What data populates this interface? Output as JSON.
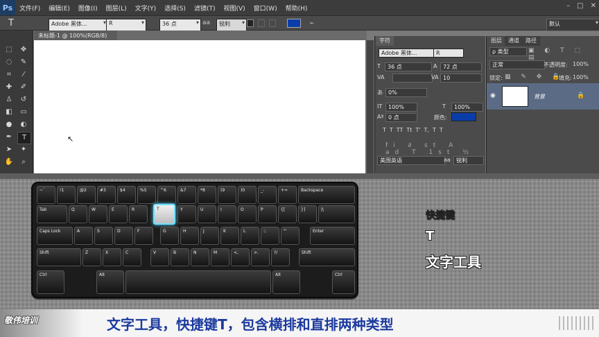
{
  "menubar": {
    "logo": "Ps",
    "items": [
      "文件(F)",
      "编辑(E)",
      "图像(I)",
      "图层(L)",
      "文字(Y)",
      "选择(S)",
      "滤镜(T)",
      "视图(V)",
      "窗口(W)",
      "帮助(H)"
    ],
    "window_controls": [
      "–",
      "□",
      "✕"
    ]
  },
  "options": {
    "tool_glyph": "T",
    "font_family": "Adobe 黑体...",
    "font_style": "R",
    "font_size": "36 点",
    "aa_glyph": "aa",
    "aa_mode": "锐利",
    "workspace": "默认",
    "color": "#0a3da8"
  },
  "document": {
    "tab_title": "未标题-1 @ 100%(RGB/8)",
    "close": "×"
  },
  "character_panel": {
    "tab": "字符",
    "font_family": "Adobe 黑体...",
    "font_style": "R",
    "size": "36 点",
    "leading": "72 点",
    "kerning": "",
    "tracking": "10",
    "scale_pct": "0%",
    "vscale": "100%",
    "hscale": "100%",
    "baseline": "0 点",
    "color_label": "颜色:",
    "color": "#0a3da8",
    "style_buttons": [
      "T",
      "T",
      "TT",
      "Tt",
      "T'",
      "T,",
      "T",
      "T"
    ],
    "lang": "美国英语",
    "aa_glyph": "aa",
    "aa": "锐利"
  },
  "layers_panel": {
    "tabs": [
      "图层",
      "通道",
      "路径"
    ],
    "kind": "ρ 类型",
    "blend": "正常",
    "opacity_label": "不透明度:",
    "opacity": "100%",
    "lock_label": "锁定:",
    "fill_label": "填充:",
    "fill": "100%",
    "layer_name": "背景"
  },
  "keyboard": {
    "rows": [
      [
        "~`",
        "!1",
        "@2",
        "#3",
        "$4",
        "%5",
        "^6",
        "&7",
        "*8",
        "(9",
        ")0",
        "_-",
        "+=",
        "Backspace"
      ],
      [
        "Tab",
        "Q",
        "W",
        "E",
        "R",
        "T",
        "Y",
        "U",
        "I",
        "O",
        "P",
        "{[",
        "}]",
        "|\\"
      ],
      [
        "Caps Lock",
        "A",
        "S",
        "D",
        "F",
        "G",
        "H",
        "J",
        "K",
        "L",
        ":;",
        "\"'",
        "Enter"
      ],
      [
        "Shift",
        "Z",
        "X",
        "C",
        "V",
        "B",
        "N",
        "M",
        "<,",
        ">.",
        "?/",
        "Shift"
      ],
      [
        "Ctrl",
        "Alt",
        "",
        "Alt",
        "Ctrl"
      ]
    ],
    "highlight": "T"
  },
  "side": {
    "title": "快捷键",
    "key": "T",
    "tool": "文字工具"
  },
  "subtitle": {
    "brand": "敬伟培训",
    "text": "文字工具，快捷键T，包含横排和直排两种类型"
  }
}
